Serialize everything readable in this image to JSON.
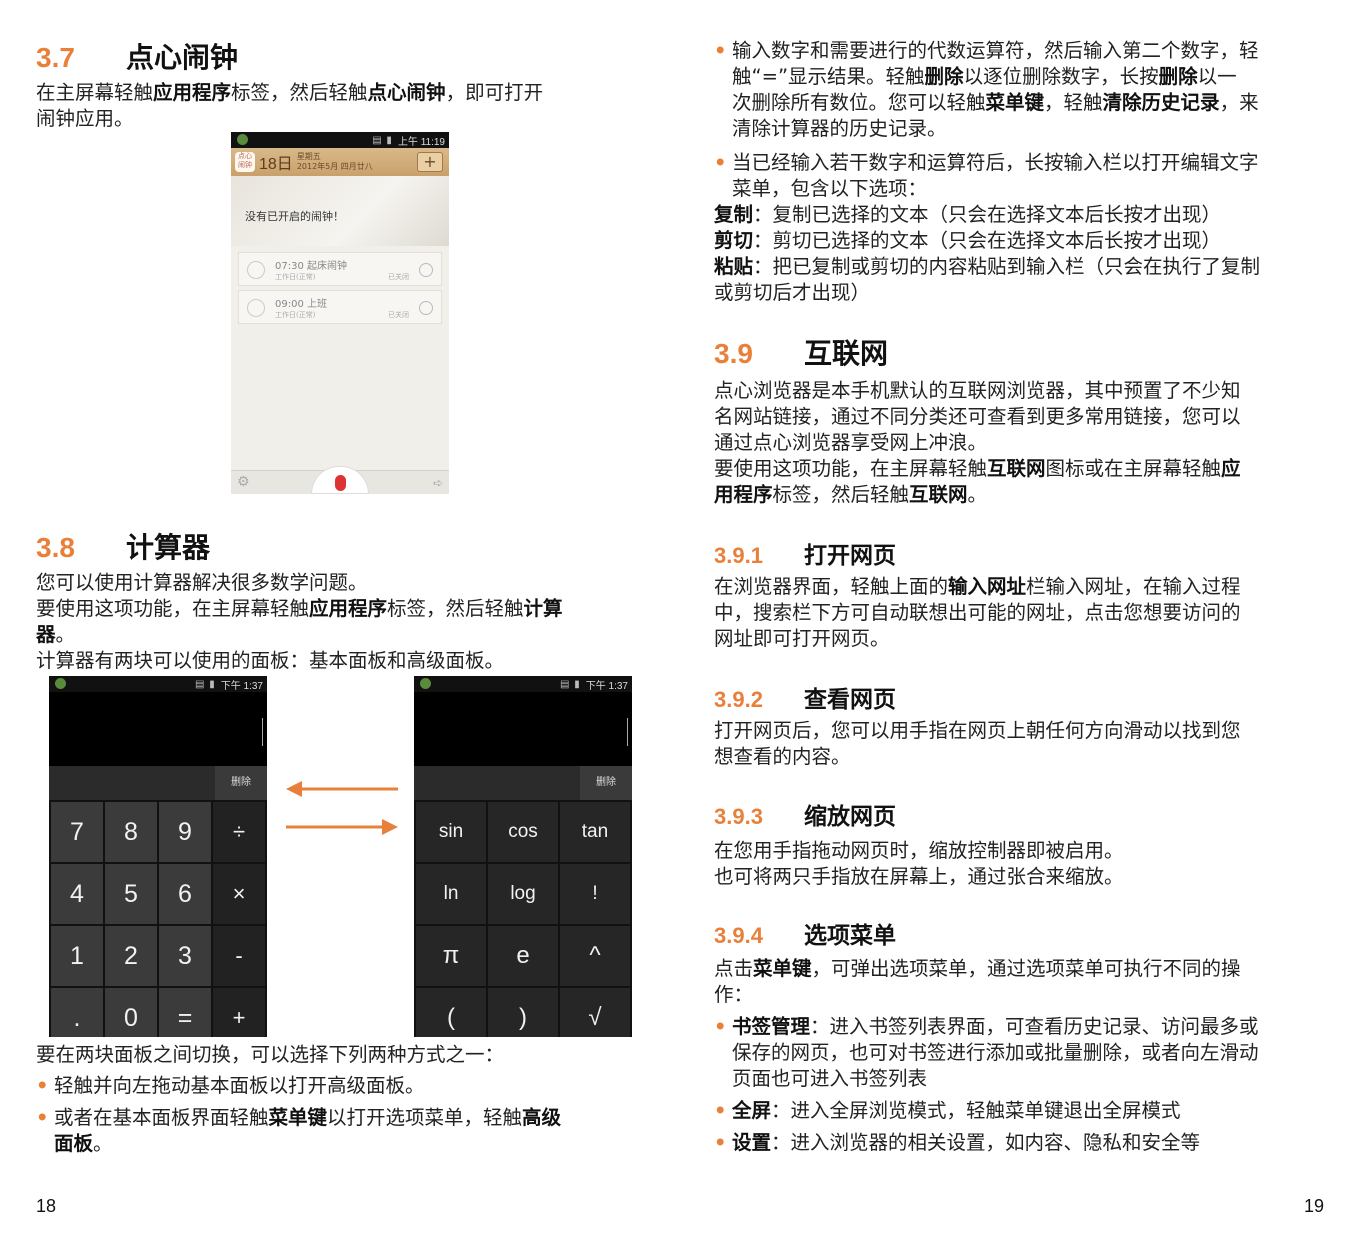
{
  "left": {
    "s37": {
      "num": "3.7",
      "title": "点心闹钟"
    },
    "p37": [
      {
        "t": "在主屏幕轻触",
        "b": false
      },
      {
        "t": "应用程序",
        "b": true
      },
      {
        "t": "标签，然后轻触",
        "b": false
      },
      {
        "t": "点心闹钟",
        "b": true
      },
      {
        "t": "，即可打开",
        "b": false
      }
    ],
    "p37_line2": "闹钟应用。",
    "alarm": {
      "time": "上午 11:19",
      "app_label": "点心闹钟",
      "day": "18日",
      "weekday": "星期五",
      "date": "2012年5月 四月廿八",
      "plus": "+",
      "no_alarm": "没有已开启的闹钟！",
      "items": [
        {
          "title": "07:30 起床闹钟",
          "sub": "工作日(正常)",
          "state": "已关闭"
        },
        {
          "title": "09:00 上班",
          "sub": "工作日(正常)",
          "state": "已关闭"
        }
      ]
    },
    "s38": {
      "num": "3.8",
      "title": "计算器"
    },
    "p38_1": "您可以使用计算器解决很多数学问题。",
    "p38_2a": "要使用这项功能，在主屏幕轻触",
    "p38_2b": "应用程序",
    "p38_2c": "标签，然后轻触",
    "p38_2d": "计算",
    "p38_2e": "器",
    "p38_2f": "。",
    "p38_3": "计算器有两块可以使用的面板：基本面板和高级面板。",
    "calc": {
      "time": "下午 1:37",
      "delete": "删除",
      "basic_keys": [
        "7",
        "8",
        "9",
        "÷",
        "4",
        "5",
        "6",
        "×",
        "1",
        "2",
        "3",
        "-",
        ".",
        "0",
        "=",
        "+"
      ],
      "adv_keys": [
        "sin",
        "cos",
        "tan",
        "ln",
        "log",
        "!",
        "π",
        "e",
        "^",
        "(",
        ")",
        "√"
      ]
    },
    "p38_4": "要在两块面板之间切换，可以选择下列两种方式之一：",
    "b1": "轻触并向左拖动基本面板以打开高级面板。",
    "b2a": "或者在基本面板界面轻触",
    "b2b": "菜单键",
    "b2c": "以打开选项菜单，轻触",
    "b2d": "高级",
    "b2e": "面板",
    "b2f": "。",
    "page_num": "18"
  },
  "right": {
    "r1_l1": "输入数字和需要进行的代数运算符，然后输入第二个数字，轻",
    "r1_l2a": "触“=”显示结果。轻触",
    "r1_l2b": "删除",
    "r1_l2c": "以逐位删除数字，长按",
    "r1_l2d": "删除",
    "r1_l2e": "以一",
    "r1_l3a": "次删除所有数位。您可以轻触",
    "r1_l3b": "菜单键",
    "r1_l3c": "，轻触",
    "r1_l3d": "清除历史记录",
    "r1_l3e": "，来",
    "r1_l4": "清除计算器的历史记录。",
    "r2_l1": "当已经输入若干数字和运算符后，长按输入栏以打开编辑文字",
    "r2_l2": "菜单，包含以下选项：",
    "copy_b": "复制",
    "copy_t": "：复制已选择的文本（只会在选择文本后长按才出现）",
    "cut_b": "剪切",
    "cut_t": "：剪切已选择的文本（只会在选择文本后长按才出现）",
    "paste_b": "粘贴",
    "paste_t": "：把已复制或剪切的内容粘贴到输入栏（只会在执行了复制",
    "paste_t2": "或剪切后才出现）",
    "s39": {
      "num": "3.9",
      "title": "互联网"
    },
    "p39_1": "点心浏览器是本手机默认的互联网浏览器，其中预置了不少知",
    "p39_2": "名网站链接，通过不同分类还可查看到更多常用链接，您可以",
    "p39_3": "通过点心浏览器享受网上冲浪。",
    "p39_4a": "要使用这项功能，在主屏幕轻触",
    "p39_4b": "互联网",
    "p39_4c": "图标或在主屏幕轻触",
    "p39_4d": "应",
    "p39_5a": "用程序",
    "p39_5b": "标签，然后轻触",
    "p39_5c": "互联网",
    "p39_5d": "。",
    "s391": {
      "num": "3.9.1",
      "title": "打开网页"
    },
    "p391_1a": "在浏览器界面，轻触上面的",
    "p391_1b": "输入网址",
    "p391_1c": "栏输入网址，在输入过程",
    "p391_2": "中，搜索栏下方可自动联想出可能的网址，点击您想要访问的",
    "p391_3": "网址即可打开网页。",
    "s392": {
      "num": "3.9.2",
      "title": "查看网页"
    },
    "p392_1": "打开网页后，您可以用手指在网页上朝任何方向滑动以找到您",
    "p392_2": "想查看的内容。",
    "s393": {
      "num": "3.9.3",
      "title": "缩放网页"
    },
    "p393_1": "在您用手指拖动网页时，缩放控制器即被启用。",
    "p393_2": "也可将两只手指放在屏幕上，通过张合来缩放。",
    "s394": {
      "num": "3.9.4",
      "title": "选项菜单"
    },
    "p394_1a": "点击",
    "p394_1b": "菜单键",
    "p394_1c": "，可弹出选项菜单，通过选项菜单可执行不同的操",
    "p394_2": "作：",
    "bm_b": "书签管理",
    "bm_t": "：进入书签列表界面，可查看历史记录、访问最多或",
    "bm_t2": "保存的网页，也可对书签进行添加或批量删除，或者向左滑动",
    "bm_t3": "页面也可进入书签列表",
    "fs_b": "全屏",
    "fs_t": "：进入全屏浏览模式，轻触菜单键退出全屏模式",
    "st_b": "设置",
    "st_t": "：进入浏览器的相关设置，如内容、隐私和安全等",
    "page_num": "19"
  },
  "colors": {
    "accent": "#e8803a",
    "text": "#222222"
  }
}
